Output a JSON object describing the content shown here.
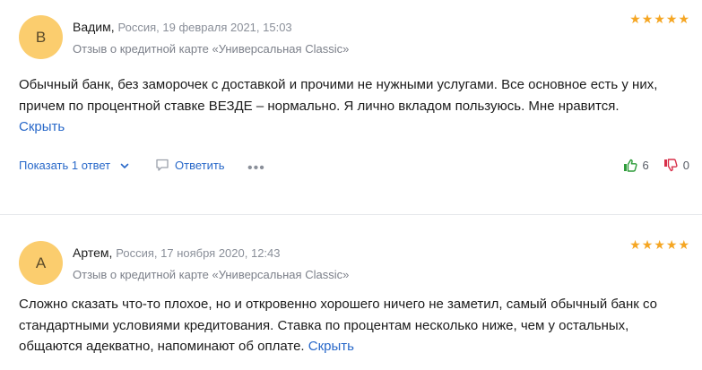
{
  "reviews": [
    {
      "avatar_letter": "В",
      "author": "Вадим,",
      "meta": "Россия, 19 февраля 2021, 15:03",
      "subtitle": "Отзыв о кредитной карте «Универсальная Classic»",
      "rating": 5,
      "text": "Обычный банк, без заморочек с доставкой и прочими не нужными услугами. Все основное есть у них, причем по процентной ставке ВЕЗДЕ – нормально. Я лично вкладом пользуюсь. Мне нравится.",
      "hide_label": "Скрыть",
      "show_replies": "Показать 1 ответ",
      "reply_label": "Ответить",
      "likes": "6",
      "dislikes": "0"
    },
    {
      "avatar_letter": "А",
      "author": "Артем,",
      "meta": "Россия, 17 ноября 2020, 12:43",
      "subtitle": "Отзыв о кредитной карте «Универсальная Classic»",
      "rating": 5,
      "text": "Сложно сказать что-то плохое, но и откровенно хорошего ничего не заметил, самый обычный банк со стандартными условиями кредитования. Ставка по процентам несколько ниже, чем у остальных, общаются адекватно, напоминают об оплате.",
      "hide_label": "Скрыть"
    }
  ],
  "colors": {
    "avatar": "#fbcd6e",
    "link": "#2868c9",
    "star": "#f5a623",
    "like": "#2e9c3a",
    "dislike": "#d8304a"
  }
}
